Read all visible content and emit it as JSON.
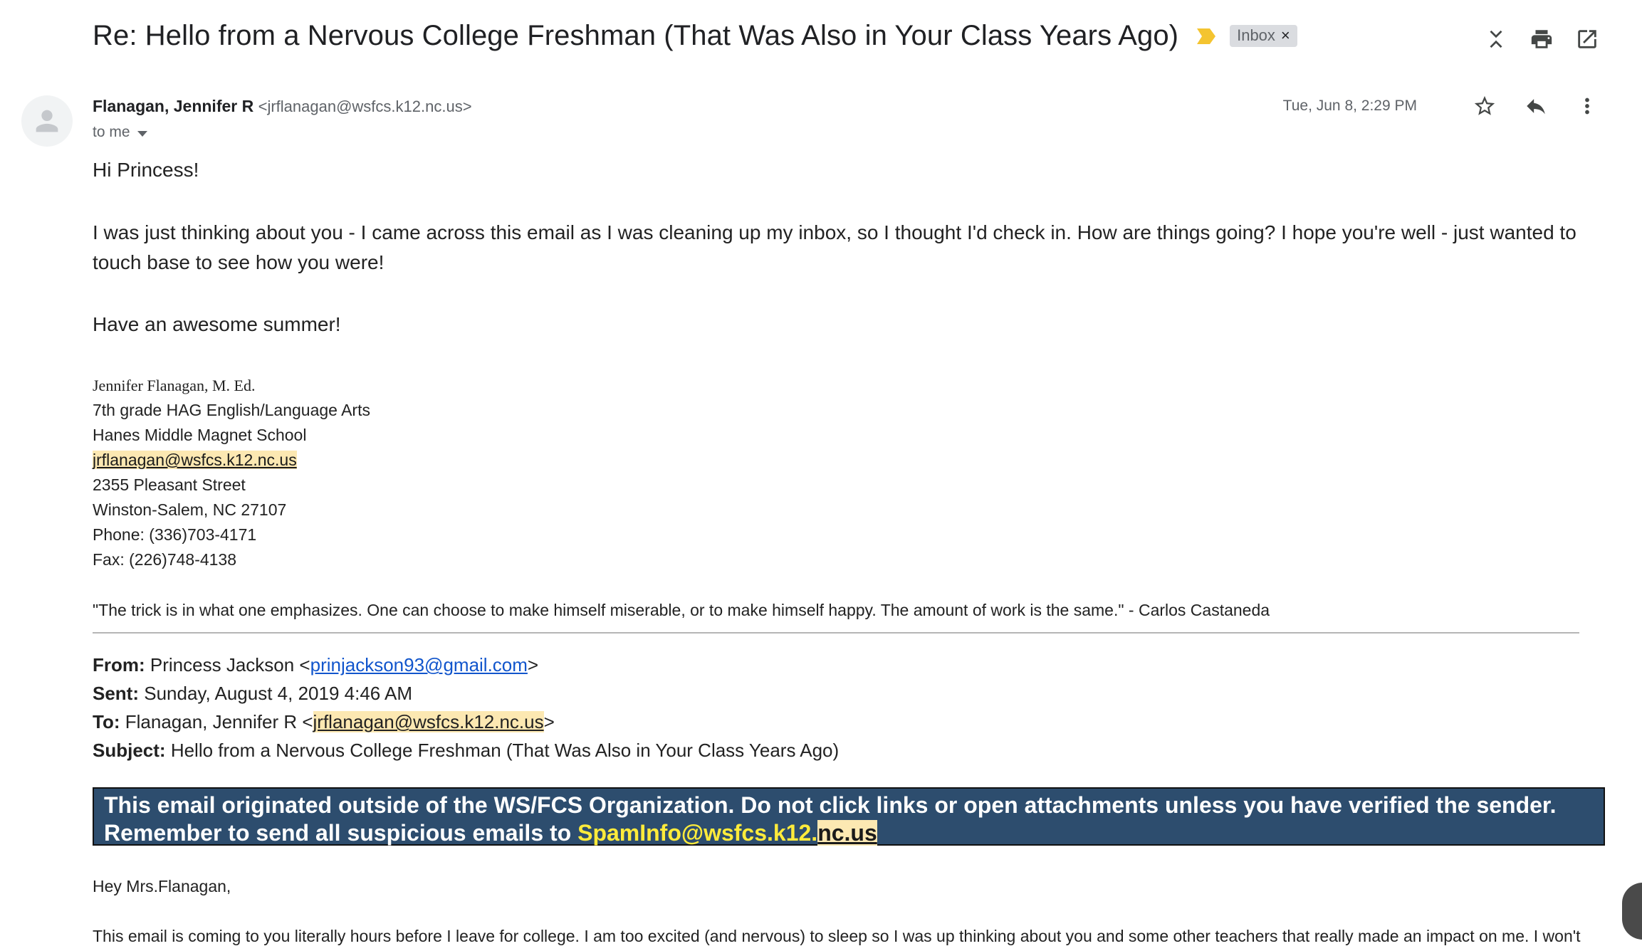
{
  "header": {
    "subject": "Re: Hello from a Nervous College Freshman (That Was Also in Your Class Years Ago)",
    "label": "Inbox",
    "label_remove": "×",
    "icons": [
      "collapse-icon",
      "print-icon",
      "open-in-new-window-icon"
    ]
  },
  "message": {
    "sender_name": "Flanagan, Jennifer R",
    "sender_email": "<jrflanagan@wsfcs.k12.nc.us>",
    "recipient": "to me",
    "date": "Tue, Jun 8, 2:29 PM",
    "icons": [
      "star-icon",
      "reply-icon",
      "more-vert-icon"
    ]
  },
  "body": {
    "greeting": "Hi Princess!",
    "paragraph": "I was just thinking about you - I came across this email as I was cleaning up my inbox, so I thought I'd check in.  How are things going?  I hope you're well - just wanted to touch base to see how you were!",
    "closing": "Have an awesome summer!"
  },
  "signature": {
    "name": "Jennifer Flanagan, M. Ed.",
    "title": "7th grade HAG English/Language Arts",
    "school": "Hanes Middle Magnet School",
    "email": "jrflanagan@wsfcs.k12.nc.us",
    "street": "2355 Pleasant Street",
    "city": "Winston-Salem, NC  27107",
    "phone": "Phone:  (336)703-4171",
    "fax": "Fax:  (226)748-4138",
    "quote": "\"The trick is in what one emphasizes.  One can choose to make himself miserable, or to make himself happy.  The amount of work is the same.\"  - Carlos Castaneda"
  },
  "quoted_header": {
    "from_label": "From:",
    "from_name": "Princess Jackson <",
    "from_email": "prinjackson93@gmail.com",
    "from_close": ">",
    "sent_label": "Sent:",
    "sent_value": "Sunday, August 4, 2019 4:46 AM",
    "to_label": "To:",
    "to_name": "Flanagan, Jennifer R <",
    "to_email": "jrflanagan@wsfcs.k12.nc.us",
    "to_close": ">",
    "subject_label": "Subject:",
    "subject_value": "Hello from a Nervous College Freshman (That Was Also in Your Class Years Ago)"
  },
  "banner": {
    "line1": "This email originated outside of the WS/FCS Organization. Do not click links or open attachments unless you have verified the sender.",
    "line2_prefix": "Remember to send all suspicious emails to ",
    "line2_email_part1": "SpamInfo@wsfcs.k12.",
    "line2_email_part2": "nc.us"
  },
  "quoted_body": {
    "greeting": "Hey Mrs.Flanagan,",
    "paragraph_start": "This email is coming to you literally hours before I leave for college. I am too excited (and nervous) to sleep so I was up thinking about you and some other teachers that really made an impact on me. I won't"
  }
}
